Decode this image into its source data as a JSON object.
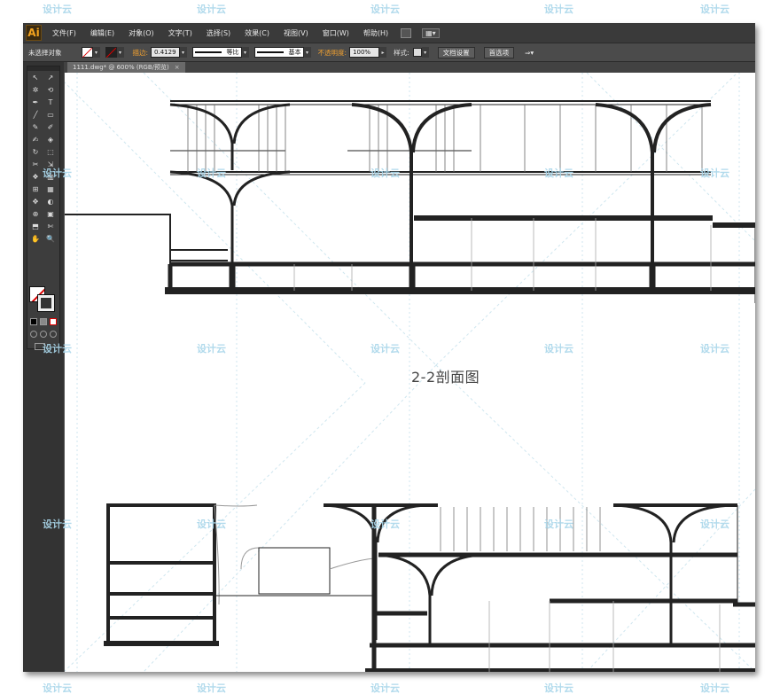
{
  "app": {
    "logo": "Ai"
  },
  "menu": [
    "文件(F)",
    "编辑(E)",
    "对象(O)",
    "文字(T)",
    "选择(S)",
    "效果(C)",
    "视图(V)",
    "窗口(W)",
    "帮助(H)"
  ],
  "menu_extras": {
    "layout_dropdown": "▦▾"
  },
  "control": {
    "selection_label": "未选择对象",
    "stroke_label": "描边:",
    "stroke_value": "0.4129",
    "profile_label": "等比",
    "brush_label": "基本",
    "opacity_label": "不透明度:",
    "opacity_value": "100%",
    "style_label": "样式:",
    "doc_setup_button": "文档设置",
    "preferences_button": "首选项"
  },
  "document_tab": {
    "title": "1111.dwg* @ 600% (RGB/预览)",
    "close": "×"
  },
  "tools": [
    "↖",
    "↗",
    "✲",
    "⟲",
    "✒",
    "T",
    "╱",
    "▭",
    "✎",
    "✐",
    "✍",
    "◈",
    "↻",
    "⬚",
    "✂",
    "⇲",
    "❖",
    "▥",
    "⊞",
    "▦",
    "✥",
    "◐",
    "⊕",
    "▣",
    "✋",
    "🔍"
  ],
  "drawing": {
    "title": "2-2剖面图"
  },
  "watermark": "设计云"
}
